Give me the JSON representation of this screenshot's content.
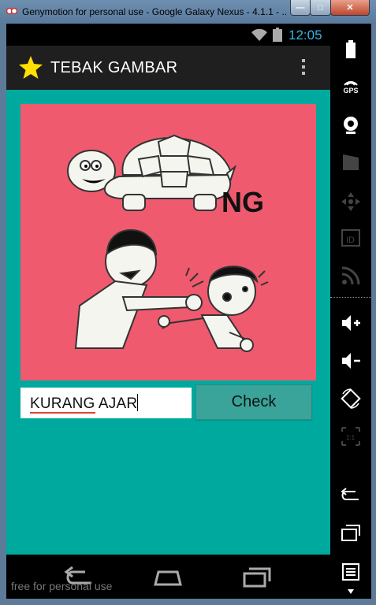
{
  "window": {
    "title": "Genymotion for personal use - Google Galaxy Nexus - 4.1.1 - ...",
    "minimize": "—",
    "maximize": "□",
    "close": "✕"
  },
  "statusbar": {
    "time": "12:05"
  },
  "app": {
    "title": "TEBAK GAMBAR",
    "image_text": "NG",
    "answer_word1": "KURANG",
    "answer_word2": " AJAR",
    "check_label": "Check"
  },
  "watermark": "free for personal use",
  "sidebar": {
    "gps_label": "GPS",
    "items": [
      "battery-icon",
      "gps-icon",
      "webcam-icon",
      "video-capture-icon",
      "dpad-icon",
      "id-icon",
      "rss-icon",
      "volume-up-icon",
      "volume-down-icon",
      "rotate-icon",
      "scale-icon",
      "back-icon",
      "recent-apps-icon",
      "menu-icon"
    ]
  },
  "colors": {
    "content_bg": "#00a99d",
    "image_bg": "#ef5a6f",
    "check_bg": "#3aa39a",
    "status_time": "#33b5e5"
  }
}
